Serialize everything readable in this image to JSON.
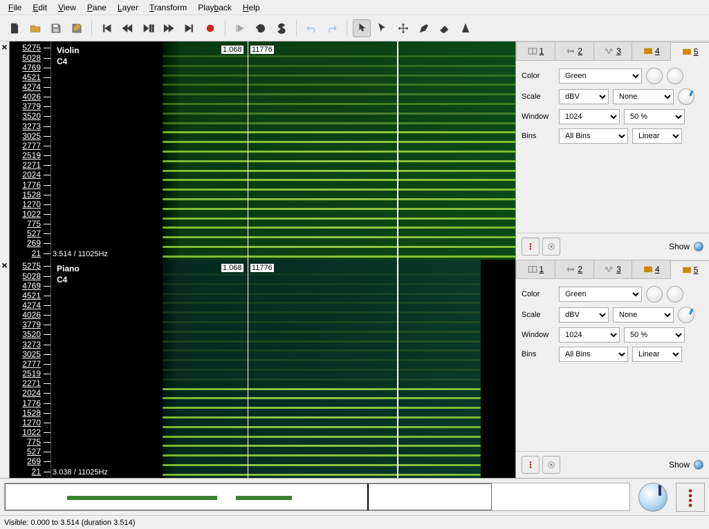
{
  "menu": {
    "file": "File",
    "edit": "Edit",
    "view": "View",
    "pane": "Pane",
    "layer": "Layer",
    "transform": "Transform",
    "playback": "Playback",
    "help": "Help"
  },
  "freq_ticks": [
    "5275",
    "5028",
    "4769",
    "4521",
    "4274",
    "4026",
    "3779",
    "3520",
    "3273",
    "3025",
    "2777",
    "2519",
    "2271",
    "2024",
    "1776",
    "1528",
    "1270",
    "1022",
    "775",
    "527",
    "269",
    "21"
  ],
  "pane1": {
    "title": "Violin",
    "note": "C4",
    "cursor_time": "1.068",
    "cursor_freq": "11776",
    "info": "3.514 / 11025Hz"
  },
  "pane2": {
    "title": "Piano",
    "note": "C4",
    "cursor_time": "1.068",
    "cursor_freq": "11776",
    "info": "3.038 / 11025Hz"
  },
  "layer_tabs": {
    "t1": "1",
    "t2": "2",
    "t3": "3",
    "t4": "4",
    "t5": "5"
  },
  "props": {
    "color_label": "Color",
    "color_value": "Green",
    "scale_label": "Scale",
    "scale_value": "dBV",
    "scale_norm": "None",
    "window_label": "Window",
    "window_value": "1024",
    "window_overlap": "50 %",
    "bins_label": "Bins",
    "bins_value": "All Bins",
    "bins_scale": "Linear",
    "show_label": "Show"
  },
  "status": "Visible: 0.000 to 3.514 (duration 3.514)"
}
